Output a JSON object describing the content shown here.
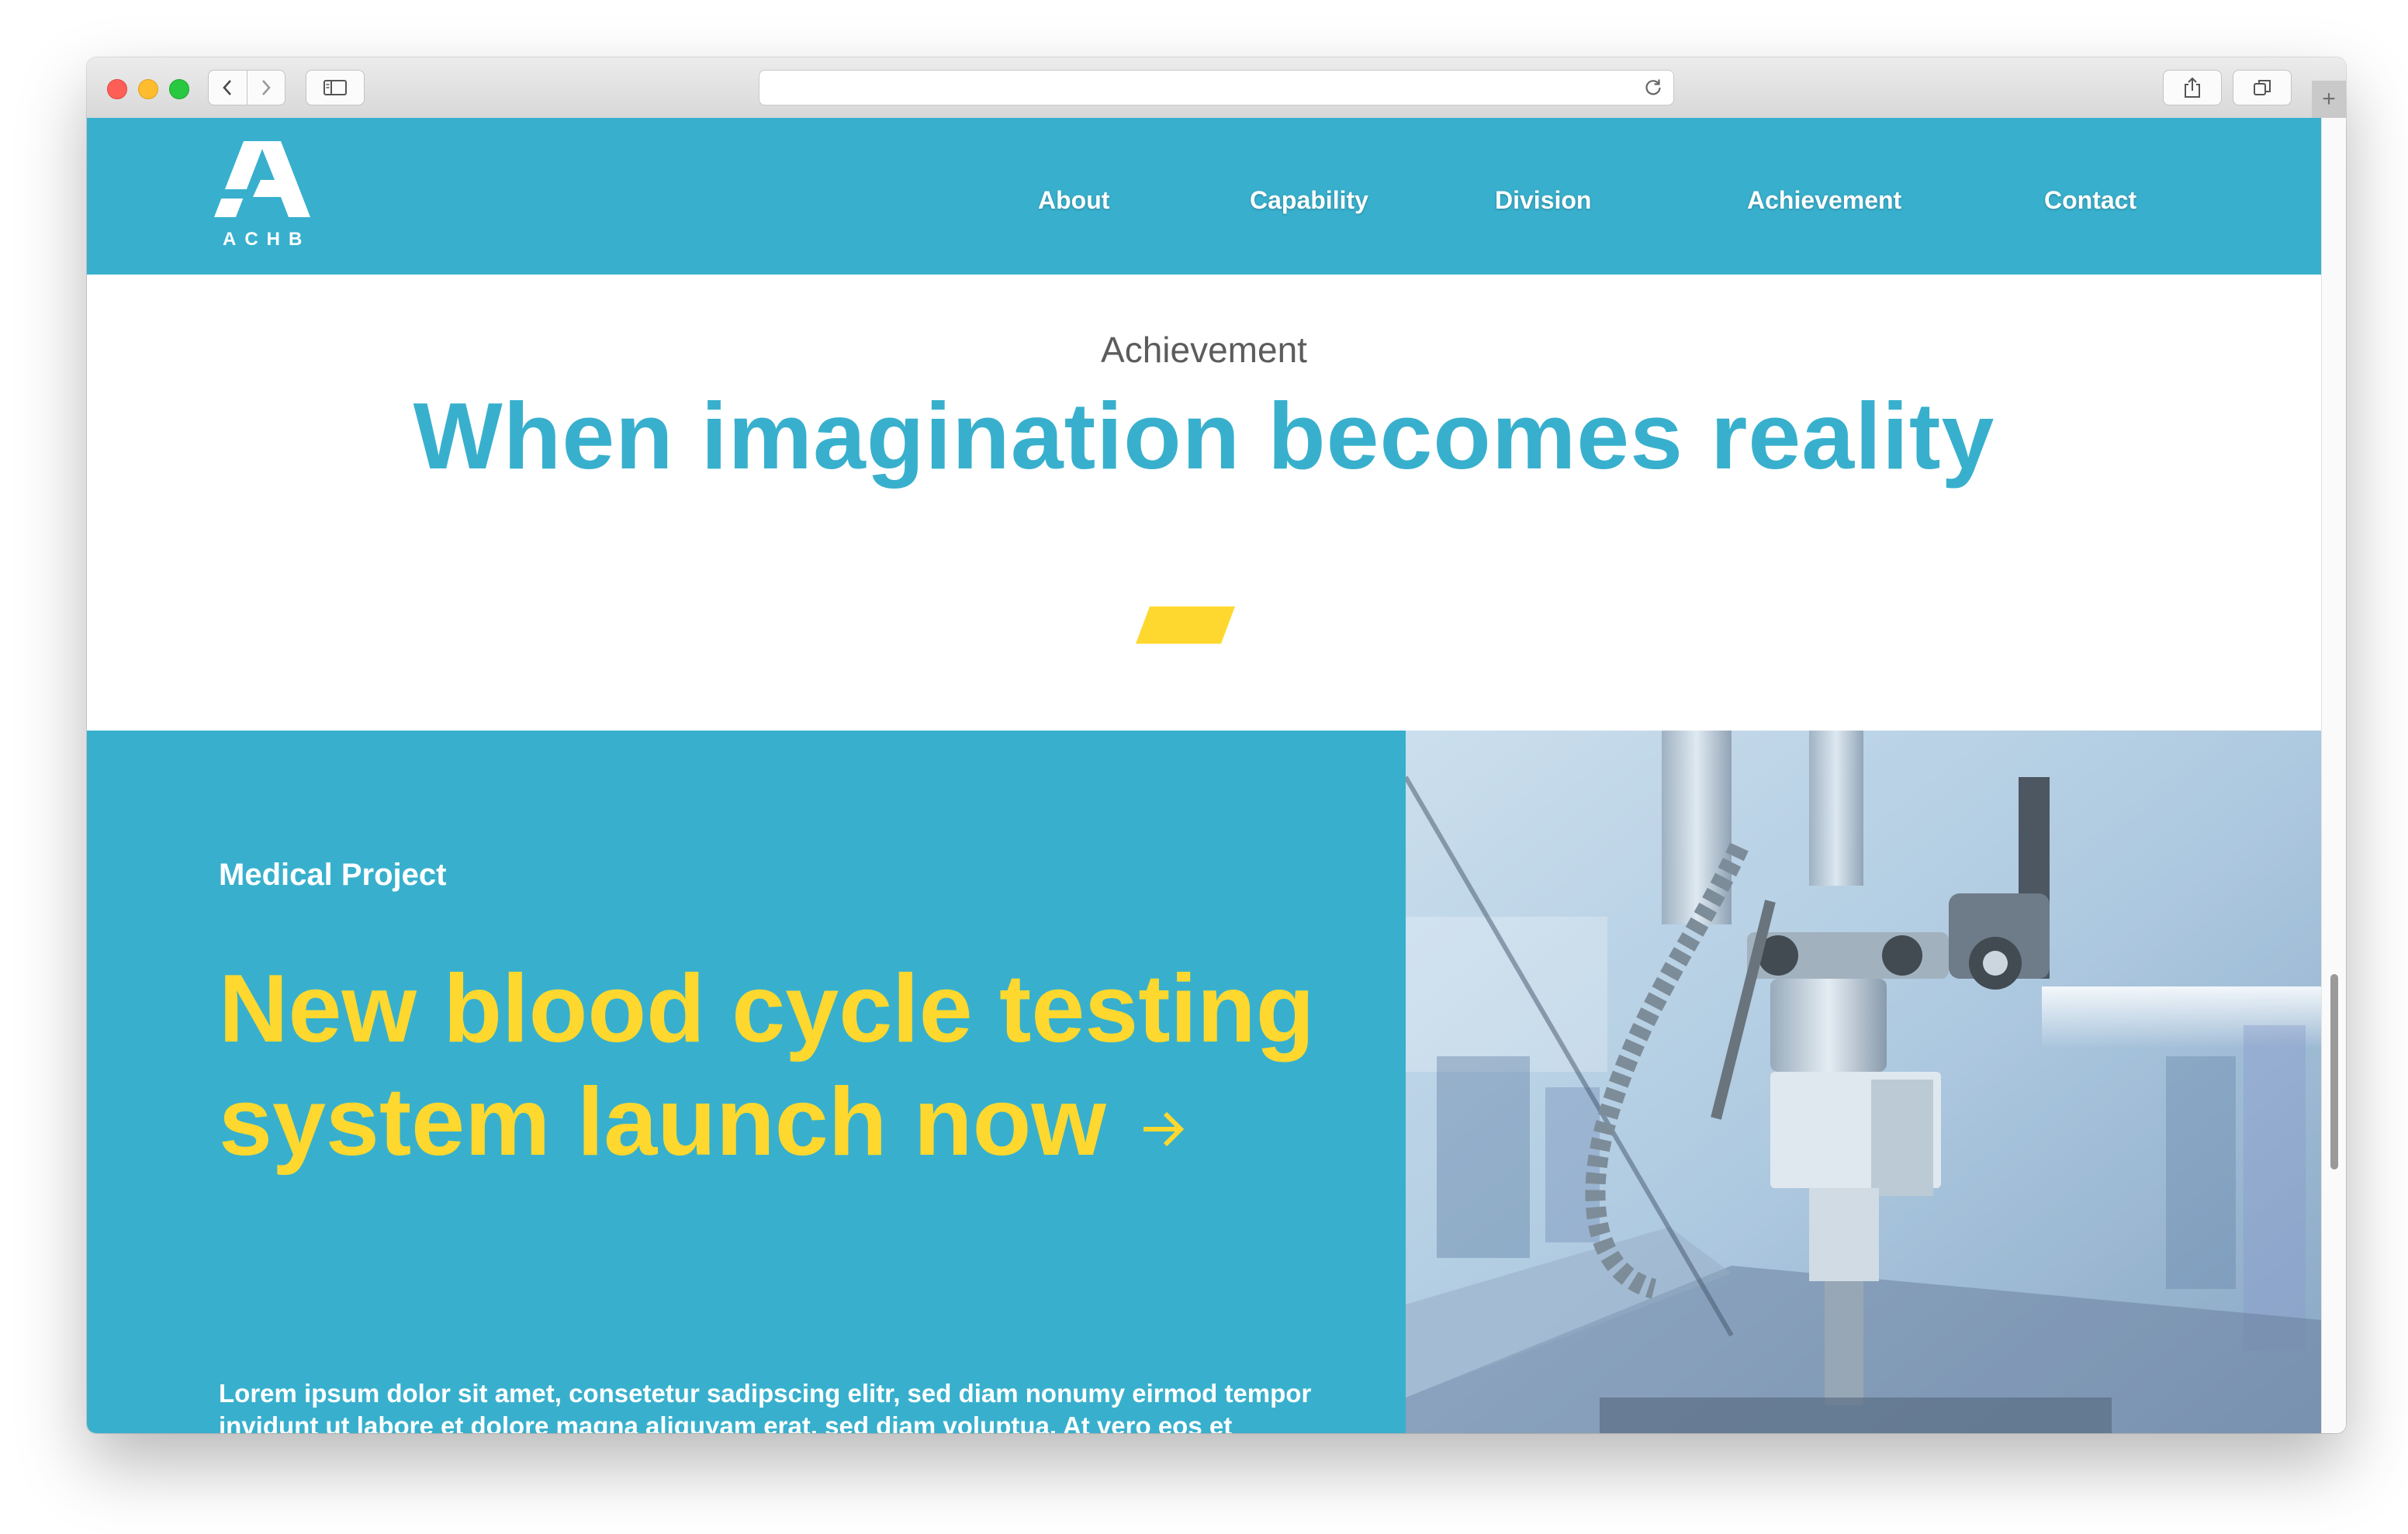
{
  "browser": {
    "address_value": "",
    "new_tab_label": "+"
  },
  "site": {
    "logo_text": "ACHB",
    "nav": [
      {
        "label": "About"
      },
      {
        "label": "Capability"
      },
      {
        "label": "Division"
      },
      {
        "label": "Achievement"
      },
      {
        "label": "Contact"
      }
    ]
  },
  "section": {
    "eyebrow": "Achievement",
    "headline": "When imagination becomes reality"
  },
  "feature": {
    "tag": "Medical Project",
    "title": "New blood cycle testing system launch now",
    "body": "Lorem ipsum dolor sit amet, consetetur sadipscing elitr, sed diam nonumy eirmod tempor invidunt ut labore et dolore magna aliquyam erat, sed diam voluptua. At vero eos et accusam et justo duo dolores et ea rebum.",
    "link_icon": "arrow-right-icon",
    "image": "industrial-robot-arm-photo"
  },
  "colors": {
    "brand_blue": "#38b0cd",
    "accent_yellow": "#fed82e",
    "eyebrow_gray": "#5c5c5c"
  }
}
